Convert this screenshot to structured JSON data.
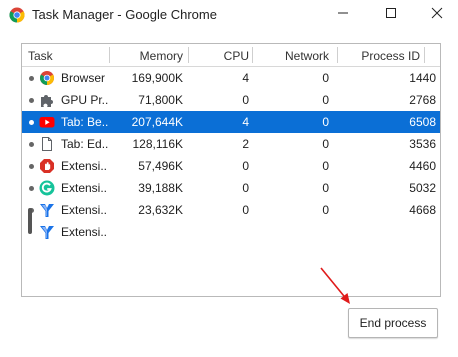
{
  "window": {
    "title": "Task Manager - Google Chrome"
  },
  "columns": {
    "task": "Task",
    "memory": "Memory",
    "cpu": "CPU",
    "network": "Network",
    "pid": "Process ID"
  },
  "rows": [
    {
      "task": "Browser",
      "memory": "169,900K",
      "cpu": "4",
      "network": "0",
      "pid": "1440",
      "icon": "chrome-icon"
    },
    {
      "task": "GPU Pr...",
      "memory": "71,800K",
      "cpu": "0",
      "network": "0",
      "pid": "2768",
      "icon": "puzzle-icon"
    },
    {
      "task": "Tab: Be...",
      "memory": "207,644K",
      "cpu": "4",
      "network": "0",
      "pid": "6508",
      "icon": "youtube-icon",
      "selected": true
    },
    {
      "task": "Tab: Ed...",
      "memory": "128,116K",
      "cpu": "2",
      "network": "0",
      "pid": "3536",
      "icon": "page-icon"
    },
    {
      "task": "Extensi...",
      "memory": "57,496K",
      "cpu": "0",
      "network": "0",
      "pid": "4460",
      "icon": "stop-sign-icon"
    },
    {
      "task": "Extensi...",
      "memory": "39,188K",
      "cpu": "0",
      "network": "0",
      "pid": "5032",
      "icon": "grammarly-icon"
    },
    {
      "task": "Extensi...",
      "memory": "23,632K",
      "cpu": "0",
      "network": "0",
      "pid": "4668",
      "icon": "blue-y-icon"
    },
    {
      "task": "Extensi...",
      "memory": "",
      "cpu": "",
      "network": "",
      "pid": "",
      "icon": "blue-y-icon"
    }
  ],
  "actions": {
    "end_process": "End process"
  },
  "colors": {
    "selection": "#0b6fd6",
    "annotation_arrow": "#e01b1b"
  }
}
